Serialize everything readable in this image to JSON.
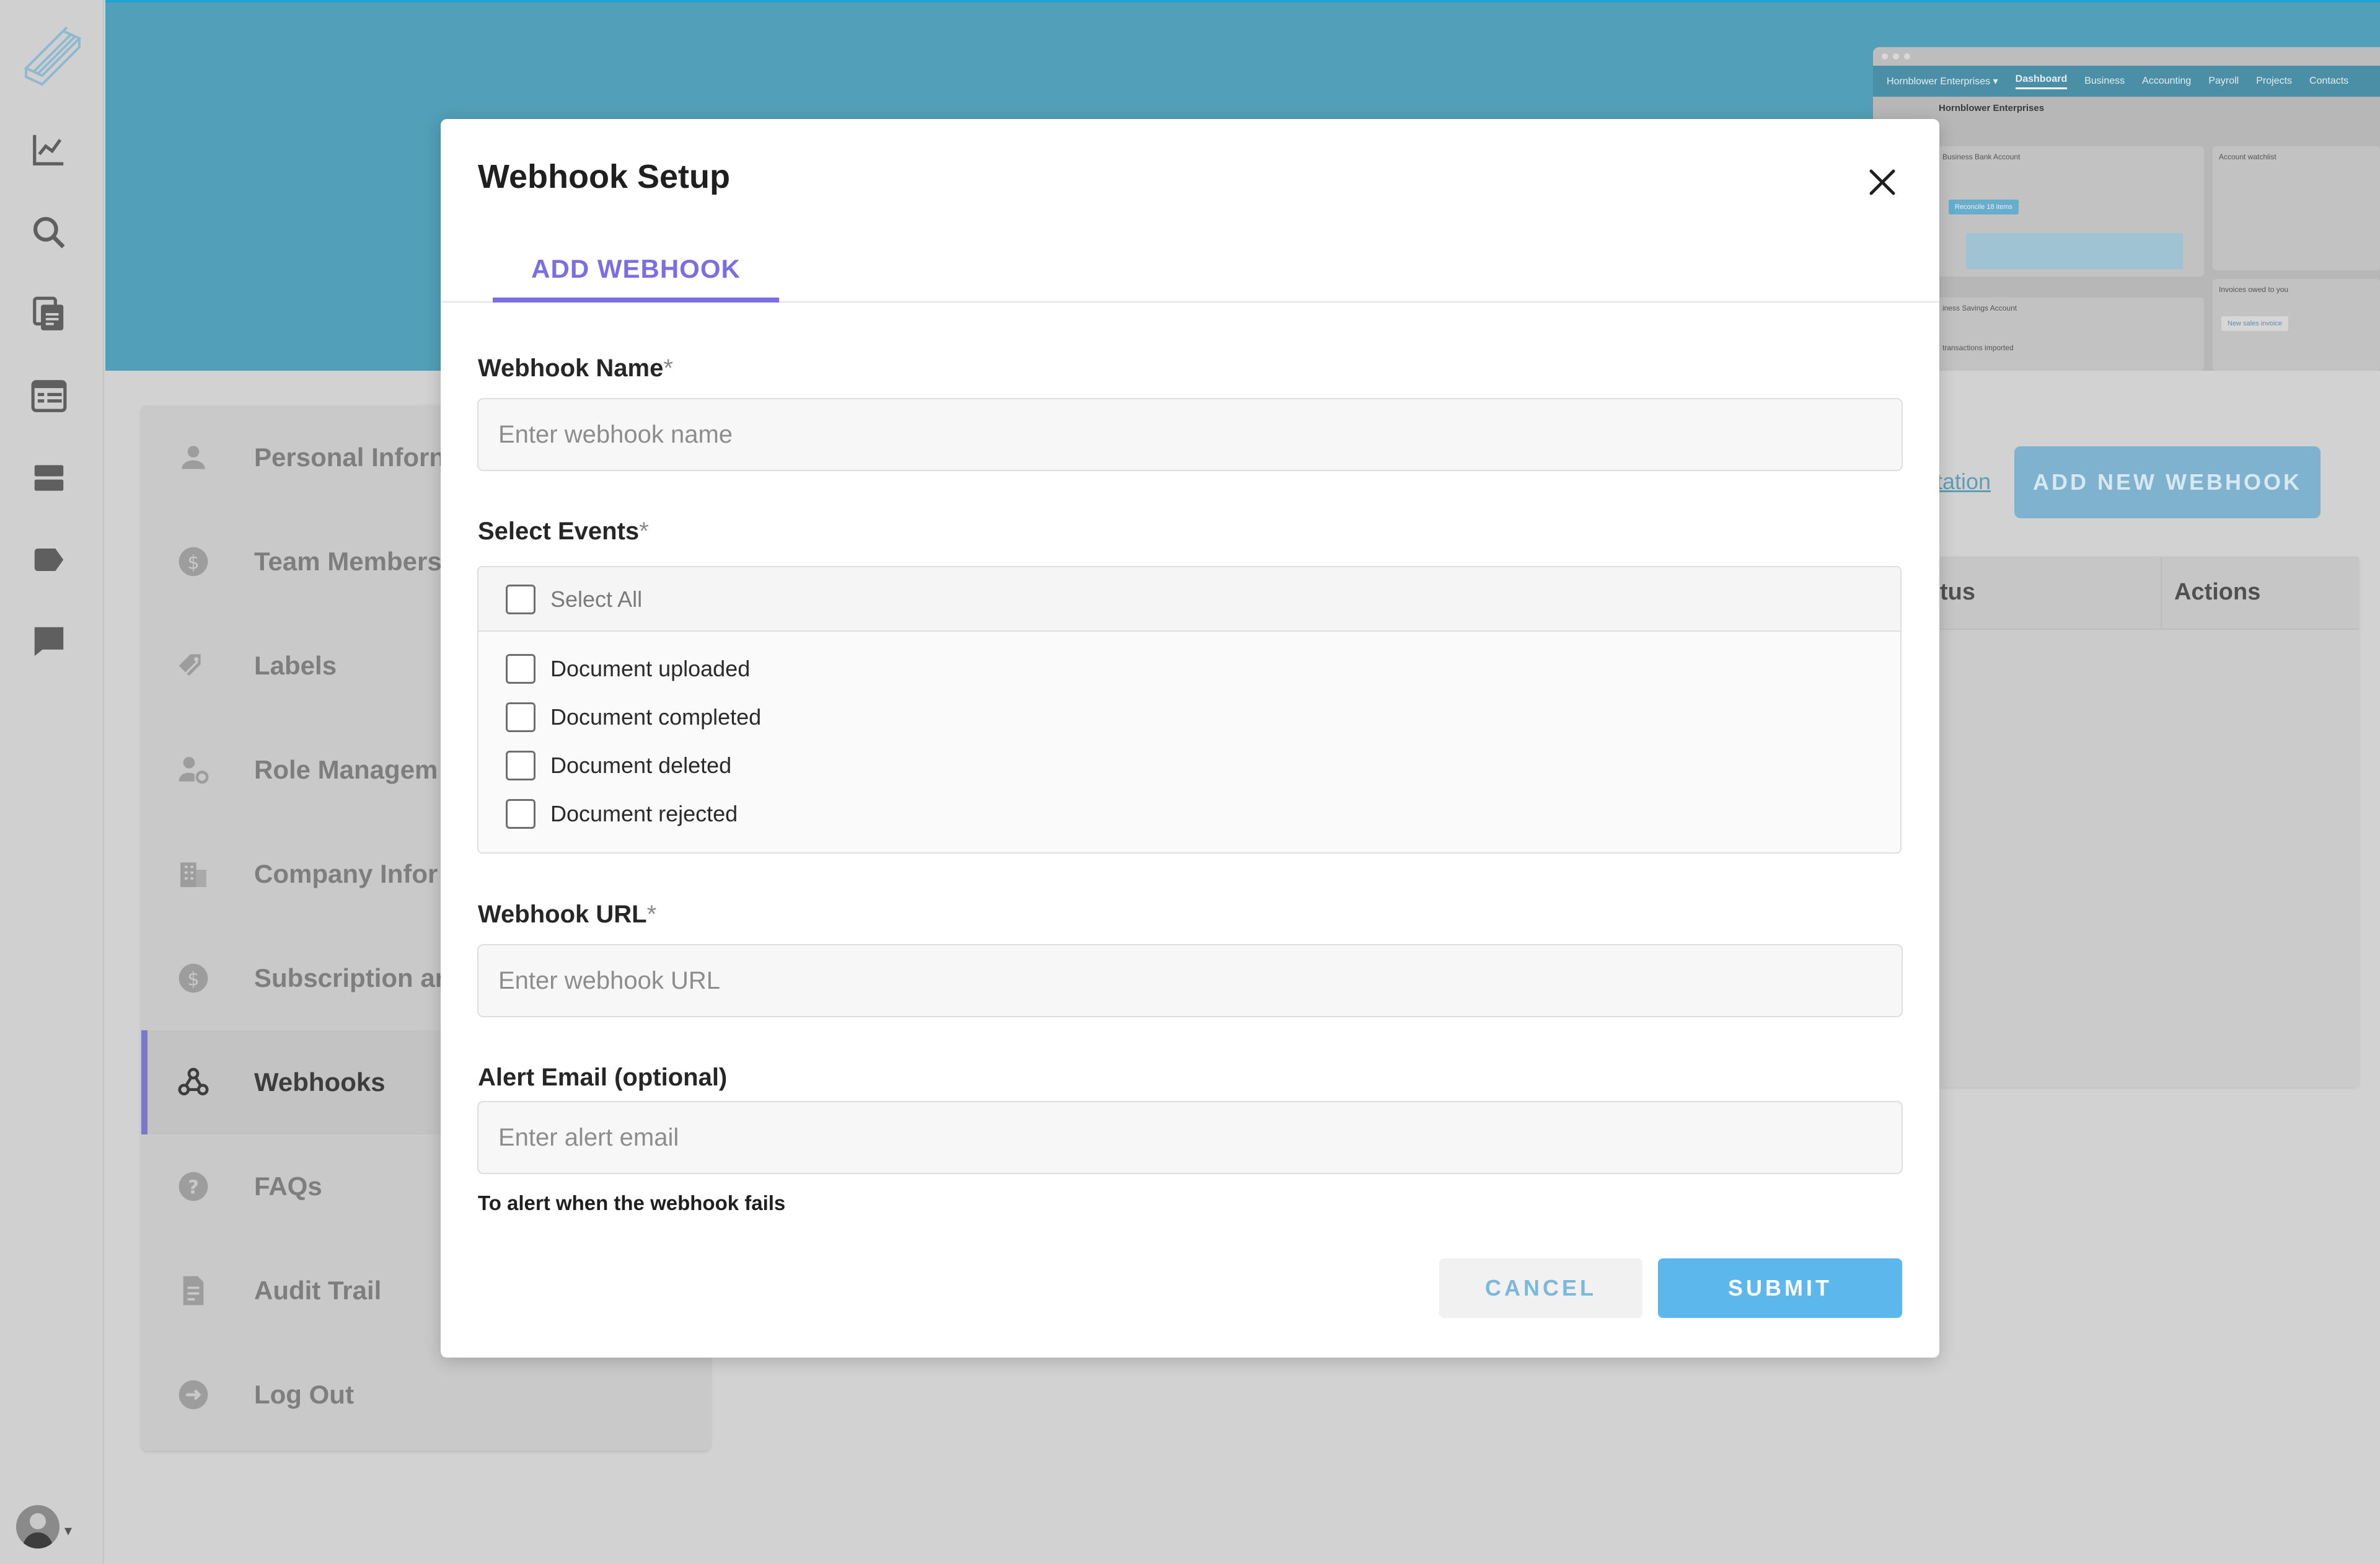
{
  "modal": {
    "title": "Webhook Setup",
    "tab_label": "ADD WEBHOOK",
    "fields": {
      "name_label": "Webhook Name",
      "name_placeholder": "Enter webhook name",
      "events_label": "Select Events",
      "url_label": "Webhook URL",
      "url_placeholder": "Enter webhook URL",
      "email_label": "Alert Email (optional)",
      "email_placeholder": "Enter alert email",
      "email_helper": "To alert when the webhook fails",
      "required_mark": "*"
    },
    "events": {
      "select_all": "Select All",
      "items": [
        "Document uploaded",
        "Document completed",
        "Document deleted",
        "Document rejected"
      ]
    },
    "buttons": {
      "cancel": "CANCEL",
      "submit": "SUBMIT"
    }
  },
  "settings_menu": {
    "items": [
      {
        "label": "Personal Inforn",
        "icon": "person-icon"
      },
      {
        "label": "Team Members",
        "icon": "dollar-circle-icon"
      },
      {
        "label": "Labels",
        "icon": "tags-icon"
      },
      {
        "label": "Role Managem",
        "icon": "user-gear-icon"
      },
      {
        "label": "Company Infor",
        "icon": "building-icon"
      },
      {
        "label": "Subscription ar",
        "icon": "dollar-circle-icon"
      },
      {
        "label": "Webhooks",
        "icon": "webhook-icon",
        "active": true
      },
      {
        "label": "FAQs",
        "icon": "question-circle-icon"
      },
      {
        "label": "Audit Trail",
        "icon": "document-icon"
      },
      {
        "label": "Log Out",
        "icon": "logout-icon"
      }
    ]
  },
  "background": {
    "doc_link": "tation",
    "add_button": "ADD NEW WEBHOOK",
    "table_headers": [
      "tus",
      "Actions"
    ]
  },
  "preview": {
    "company": "Hornblower Enterprises ▾",
    "nav": [
      "Dashboard",
      "Business",
      "Accounting",
      "Payroll",
      "Projects",
      "Contacts"
    ],
    "title": "Hornblower Enterprises",
    "card1_title": "Business Bank Account",
    "card1_btn": "Reconcile 18 items",
    "card2_title": "Account watchlist",
    "card3_title": "iness Savings Account",
    "card3_sub": "transactions imported",
    "card4_title": "Invoices owed to you",
    "card4_btn": "New sales invoice"
  },
  "colors": {
    "accent": "#7c6ee2",
    "submit": "#5cb7ec",
    "hero": "#519fb9"
  }
}
